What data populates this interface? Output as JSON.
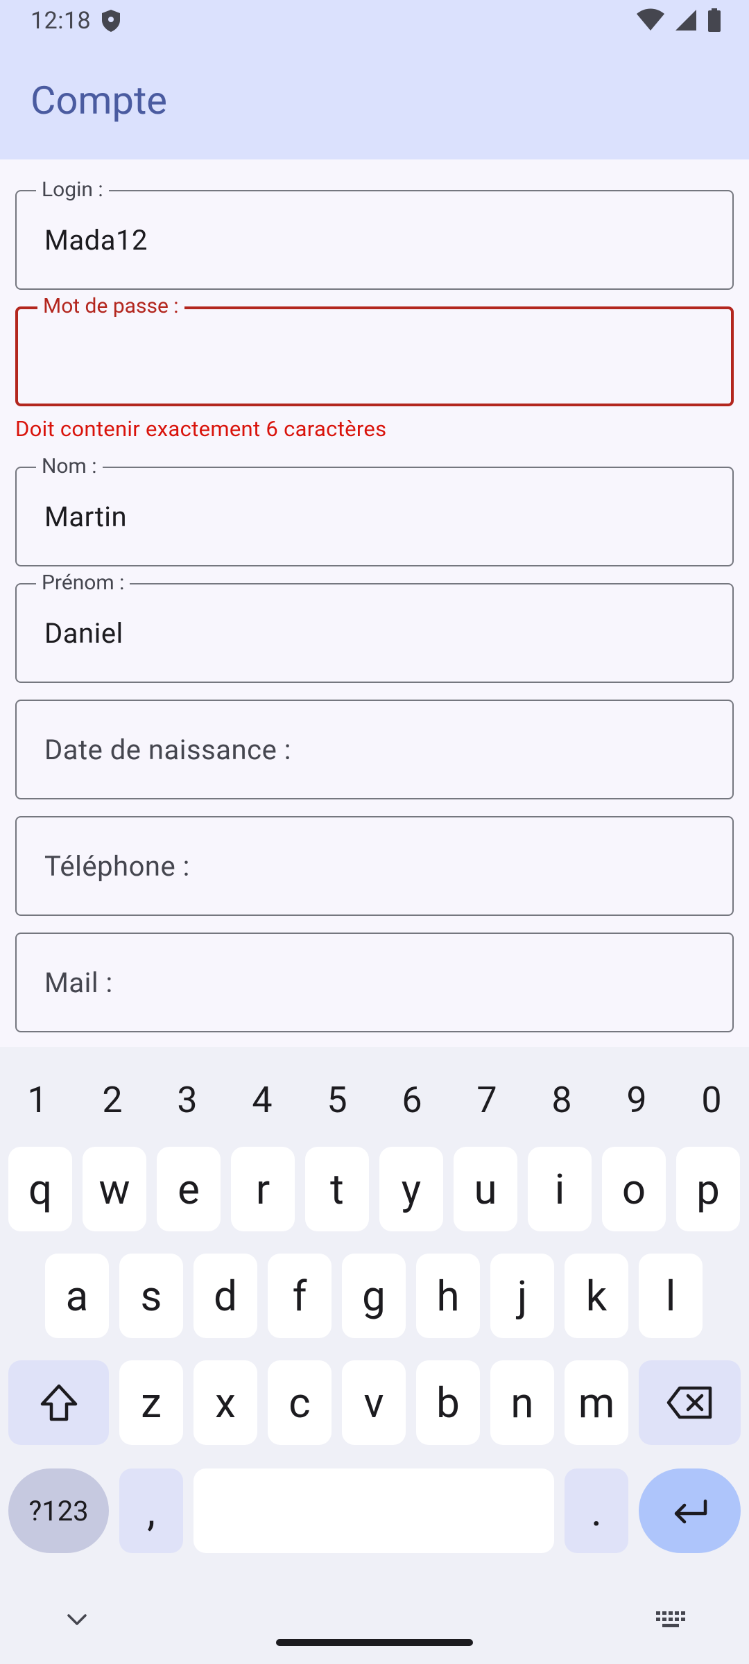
{
  "status_bar": {
    "time": "12:18"
  },
  "app_bar": {
    "title": "Compte"
  },
  "form": {
    "login": {
      "label": "Login :",
      "value": "Mada12"
    },
    "password": {
      "label": "Mot de passe :",
      "value": "",
      "error": "Doit contenir exactement 6 caractères"
    },
    "nom": {
      "label": "Nom :",
      "value": "Martin"
    },
    "prenom": {
      "label": "Prénom :",
      "value": "Daniel"
    },
    "date": {
      "placeholder": "Date de naissance :"
    },
    "telephone": {
      "placeholder": "Téléphone :"
    },
    "mail": {
      "placeholder": "Mail :"
    }
  },
  "keyboard": {
    "numbers": [
      "1",
      "2",
      "3",
      "4",
      "5",
      "6",
      "7",
      "8",
      "9",
      "0"
    ],
    "row1": [
      "q",
      "w",
      "e",
      "r",
      "t",
      "y",
      "u",
      "i",
      "o",
      "p"
    ],
    "row2": [
      "a",
      "s",
      "d",
      "f",
      "g",
      "h",
      "j",
      "k",
      "l"
    ],
    "row3": [
      "z",
      "x",
      "c",
      "v",
      "b",
      "n",
      "m"
    ],
    "symbols_label": "?123",
    "comma": ",",
    "period": "."
  },
  "colors": {
    "app_bar_bg": "#dbe1fd",
    "title": "#4a5ba0",
    "error": "#b3261e",
    "enter_key": "#aec5fb"
  }
}
